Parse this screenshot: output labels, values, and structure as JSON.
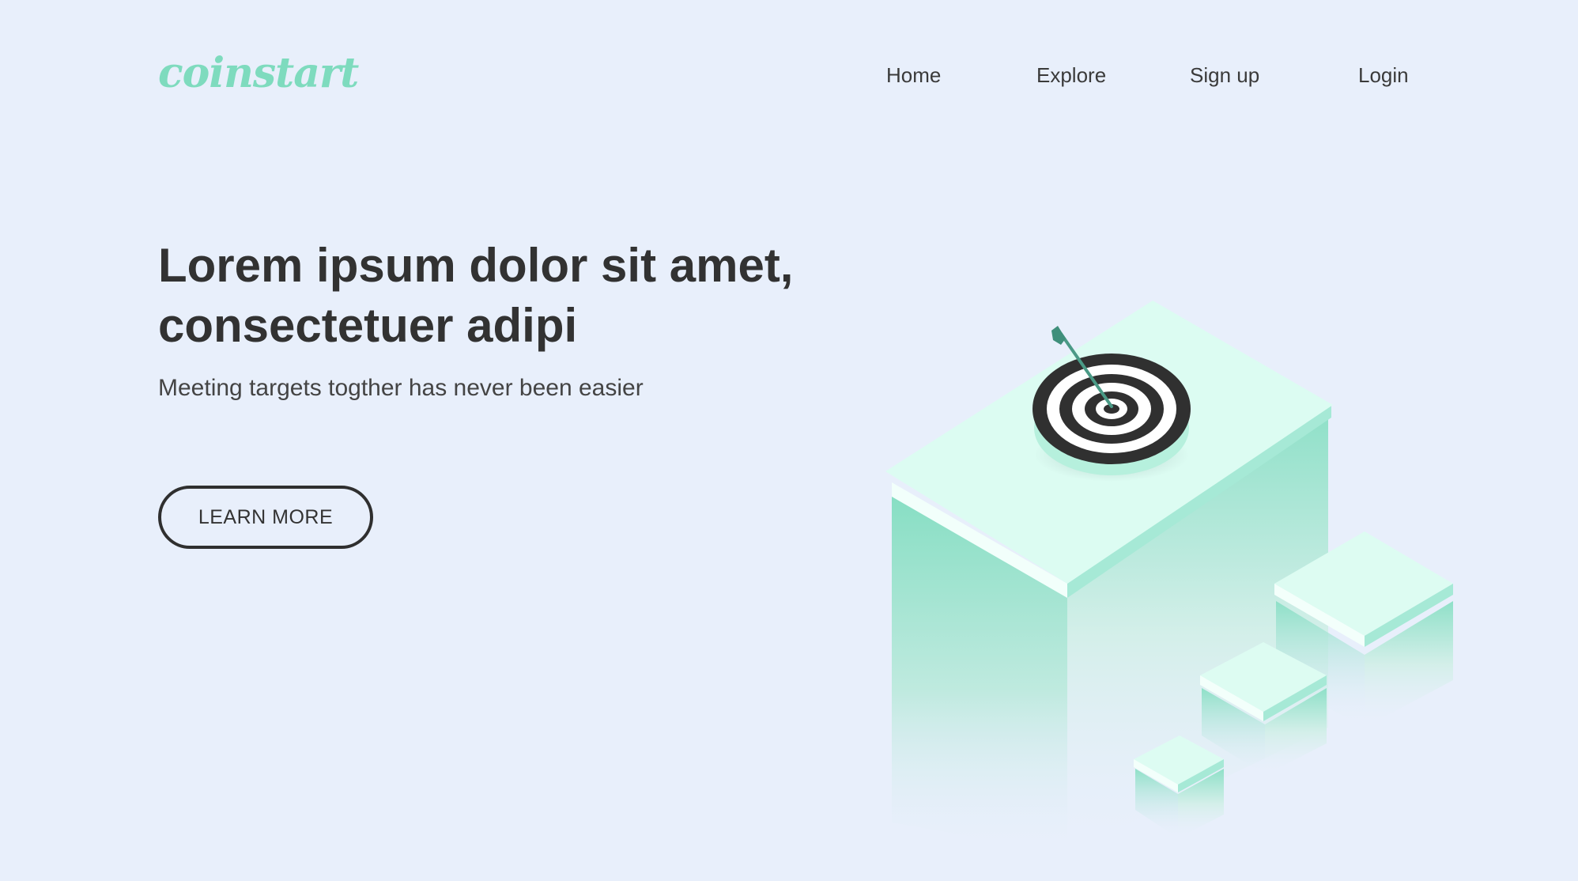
{
  "brand": {
    "logo_text": "coinstart",
    "accent_color": "#7edbbe"
  },
  "nav": {
    "items": [
      {
        "label": "Home"
      },
      {
        "label": "Explore"
      },
      {
        "label": "Sign up"
      },
      {
        "label": "Login"
      }
    ]
  },
  "hero": {
    "title": "Lorem ipsum dolor sit amet, consectetuer adipi",
    "subtitle": "Meeting targets togther has never been easier",
    "cta_label": "LEARN MORE"
  },
  "illustration": {
    "icon": "target-icon",
    "description_icon_names": [
      "dartboard-icon",
      "dart-icon",
      "isometric-blocks"
    ]
  },
  "colors": {
    "background": "#e8effb",
    "text": "#323232",
    "block_top": "#defcf3",
    "block_side": "#86dec3"
  }
}
